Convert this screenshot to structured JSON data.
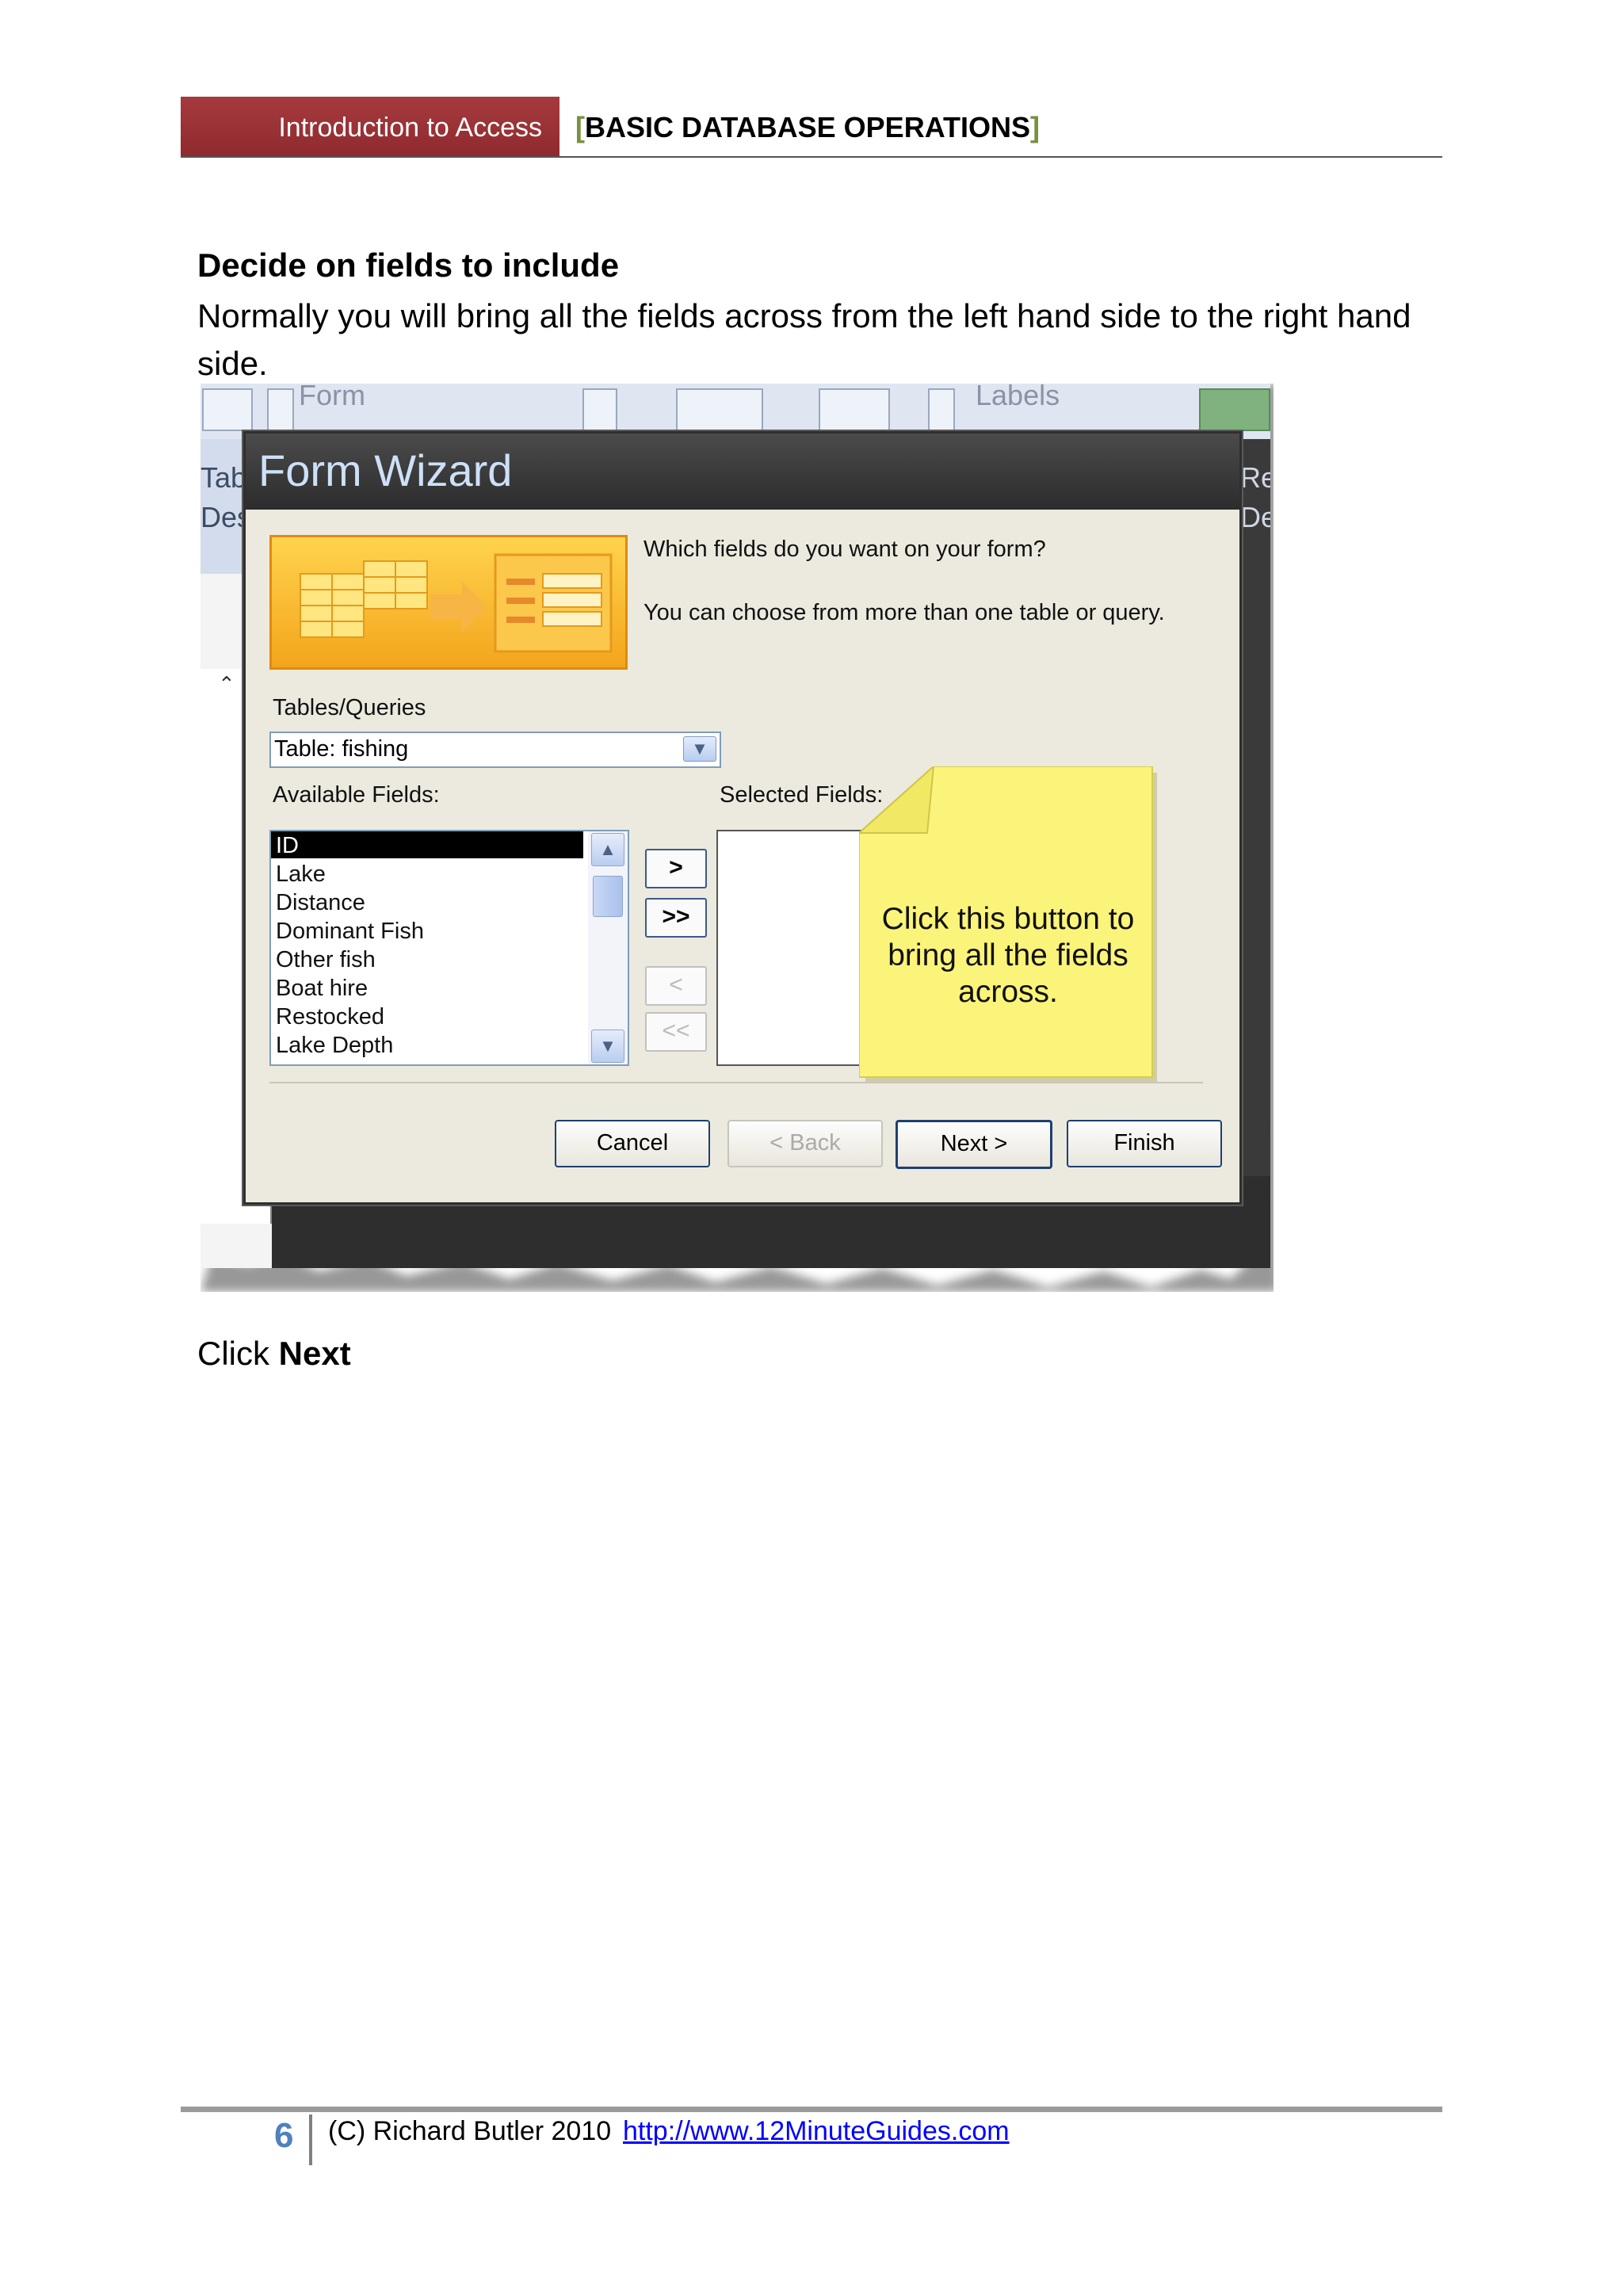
{
  "header": {
    "left_label": "Introduction to Access",
    "bracket_open": "[",
    "section_title": "BASIC DATABASE OPERATIONS",
    "bracket_close": "]"
  },
  "content": {
    "heading": "Decide on fields to include",
    "paragraph": "Normally you will bring all the fields across from the left hand side to the right hand side.",
    "click_prefix": "Click ",
    "click_bold": "Next"
  },
  "background_window": {
    "ribbon_fragments": [
      "Form",
      "Labels"
    ],
    "nav_fragments": [
      "Tab",
      "Desi",
      "Repor",
      "Desig"
    ]
  },
  "form_wizard": {
    "title": "Form Wizard",
    "question": "Which fields do you want on your form?",
    "hint": "You can choose from more than one table or query.",
    "tables_label": "Tables/Queries",
    "table_value": "Table: fishing",
    "available_label": "Available Fields:",
    "selected_label": "Selected Fields:",
    "available_fields": [
      "ID",
      "Lake",
      "Distance",
      "Dominant Fish",
      "Other fish",
      "Boat hire",
      "Restocked",
      "Lake Depth"
    ],
    "move_one": ">",
    "move_all": ">>",
    "remove_one": "<",
    "remove_all": "<<",
    "cancel": "Cancel",
    "back": "< Back",
    "next": "Next >",
    "finish": "Finish"
  },
  "callout": {
    "text": "Click this button to bring all the fields across."
  },
  "footer": {
    "page_number": "6",
    "copyright": "(C) Richard Butler 2010",
    "url": "http://www.12MinuteGuides.com"
  },
  "colors": {
    "header_band": "#9b3337",
    "bracket": "#76923c",
    "page_number": "#4f81bd",
    "link": "#0000ff",
    "callout": "#fbf47a",
    "arrow": "#c8181e"
  }
}
